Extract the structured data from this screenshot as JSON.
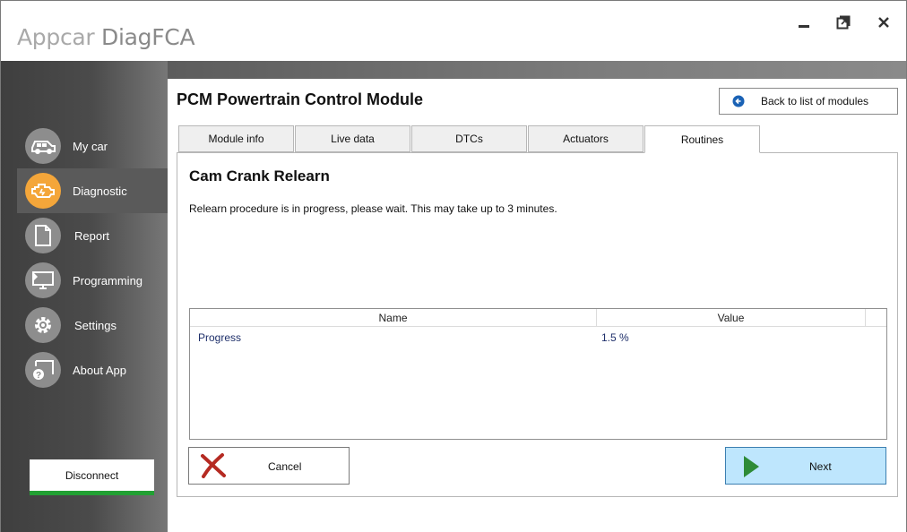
{
  "app": {
    "title_part1": "Appcar",
    "title_part2": "DiagFCA"
  },
  "window_controls": {
    "minimize_icon": "minimize-icon",
    "maximize_icon": "restore-icon",
    "close_icon": "close-icon"
  },
  "sidebar": {
    "items": [
      {
        "label": "My car",
        "icon": "car-icon",
        "active": false
      },
      {
        "label": "Diagnostic",
        "icon": "engine-icon",
        "active": true
      },
      {
        "label": "Report",
        "icon": "document-icon",
        "active": false
      },
      {
        "label": "Programming",
        "icon": "monitor-icon",
        "active": false
      },
      {
        "label": "Settings",
        "icon": "gear-icon",
        "active": false
      },
      {
        "label": "About App",
        "icon": "help-window-icon",
        "active": false
      }
    ],
    "disconnect_label": "Disconnect"
  },
  "header": {
    "module_title": "PCM Powertrain Control Module",
    "back_label": "Back to list of modules"
  },
  "tabs": [
    {
      "label": "Module info",
      "active": false
    },
    {
      "label": "Live data",
      "active": false
    },
    {
      "label": "DTCs",
      "active": false
    },
    {
      "label": "Actuators",
      "active": false
    },
    {
      "label": "Routines",
      "active": true
    }
  ],
  "routine": {
    "title": "Cam Crank Relearn",
    "message": "Relearn procedure is in progress, please wait. This may take up to 3 minutes."
  },
  "grid": {
    "columns": [
      "Name",
      "Value"
    ],
    "rows": [
      {
        "name": "Progress",
        "value": "1.5 %"
      }
    ]
  },
  "actions": {
    "cancel_label": "Cancel",
    "next_label": "Next"
  },
  "colors": {
    "accent_active": "#f4a63a",
    "disconnect_bar": "#22a033",
    "next_bg": "#bee6fd",
    "cancel_icon": "#b52a22",
    "next_icon": "#2e8b37"
  }
}
